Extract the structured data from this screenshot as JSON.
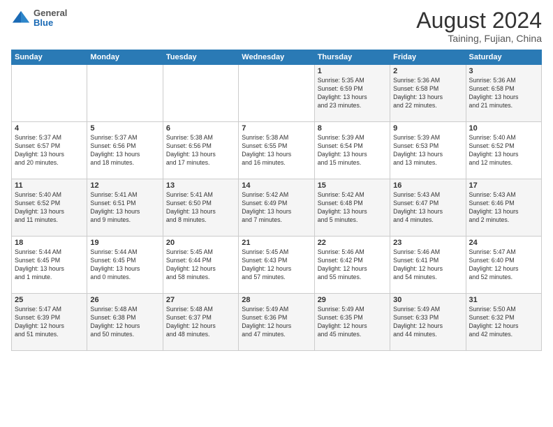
{
  "header": {
    "logo": {
      "line1": "General",
      "line2": "Blue"
    },
    "title": "August 2024",
    "location": "Taining, Fujian, China"
  },
  "weekdays": [
    "Sunday",
    "Monday",
    "Tuesday",
    "Wednesday",
    "Thursday",
    "Friday",
    "Saturday"
  ],
  "weeks": [
    [
      {
        "day": "",
        "info": ""
      },
      {
        "day": "",
        "info": ""
      },
      {
        "day": "",
        "info": ""
      },
      {
        "day": "",
        "info": ""
      },
      {
        "day": "1",
        "info": "Sunrise: 5:35 AM\nSunset: 6:59 PM\nDaylight: 13 hours\nand 23 minutes."
      },
      {
        "day": "2",
        "info": "Sunrise: 5:36 AM\nSunset: 6:58 PM\nDaylight: 13 hours\nand 22 minutes."
      },
      {
        "day": "3",
        "info": "Sunrise: 5:36 AM\nSunset: 6:58 PM\nDaylight: 13 hours\nand 21 minutes."
      }
    ],
    [
      {
        "day": "4",
        "info": "Sunrise: 5:37 AM\nSunset: 6:57 PM\nDaylight: 13 hours\nand 20 minutes."
      },
      {
        "day": "5",
        "info": "Sunrise: 5:37 AM\nSunset: 6:56 PM\nDaylight: 13 hours\nand 18 minutes."
      },
      {
        "day": "6",
        "info": "Sunrise: 5:38 AM\nSunset: 6:56 PM\nDaylight: 13 hours\nand 17 minutes."
      },
      {
        "day": "7",
        "info": "Sunrise: 5:38 AM\nSunset: 6:55 PM\nDaylight: 13 hours\nand 16 minutes."
      },
      {
        "day": "8",
        "info": "Sunrise: 5:39 AM\nSunset: 6:54 PM\nDaylight: 13 hours\nand 15 minutes."
      },
      {
        "day": "9",
        "info": "Sunrise: 5:39 AM\nSunset: 6:53 PM\nDaylight: 13 hours\nand 13 minutes."
      },
      {
        "day": "10",
        "info": "Sunrise: 5:40 AM\nSunset: 6:52 PM\nDaylight: 13 hours\nand 12 minutes."
      }
    ],
    [
      {
        "day": "11",
        "info": "Sunrise: 5:40 AM\nSunset: 6:52 PM\nDaylight: 13 hours\nand 11 minutes."
      },
      {
        "day": "12",
        "info": "Sunrise: 5:41 AM\nSunset: 6:51 PM\nDaylight: 13 hours\nand 9 minutes."
      },
      {
        "day": "13",
        "info": "Sunrise: 5:41 AM\nSunset: 6:50 PM\nDaylight: 13 hours\nand 8 minutes."
      },
      {
        "day": "14",
        "info": "Sunrise: 5:42 AM\nSunset: 6:49 PM\nDaylight: 13 hours\nand 7 minutes."
      },
      {
        "day": "15",
        "info": "Sunrise: 5:42 AM\nSunset: 6:48 PM\nDaylight: 13 hours\nand 5 minutes."
      },
      {
        "day": "16",
        "info": "Sunrise: 5:43 AM\nSunset: 6:47 PM\nDaylight: 13 hours\nand 4 minutes."
      },
      {
        "day": "17",
        "info": "Sunrise: 5:43 AM\nSunset: 6:46 PM\nDaylight: 13 hours\nand 2 minutes."
      }
    ],
    [
      {
        "day": "18",
        "info": "Sunrise: 5:44 AM\nSunset: 6:45 PM\nDaylight: 13 hours\nand 1 minute."
      },
      {
        "day": "19",
        "info": "Sunrise: 5:44 AM\nSunset: 6:45 PM\nDaylight: 13 hours\nand 0 minutes."
      },
      {
        "day": "20",
        "info": "Sunrise: 5:45 AM\nSunset: 6:44 PM\nDaylight: 12 hours\nand 58 minutes."
      },
      {
        "day": "21",
        "info": "Sunrise: 5:45 AM\nSunset: 6:43 PM\nDaylight: 12 hours\nand 57 minutes."
      },
      {
        "day": "22",
        "info": "Sunrise: 5:46 AM\nSunset: 6:42 PM\nDaylight: 12 hours\nand 55 minutes."
      },
      {
        "day": "23",
        "info": "Sunrise: 5:46 AM\nSunset: 6:41 PM\nDaylight: 12 hours\nand 54 minutes."
      },
      {
        "day": "24",
        "info": "Sunrise: 5:47 AM\nSunset: 6:40 PM\nDaylight: 12 hours\nand 52 minutes."
      }
    ],
    [
      {
        "day": "25",
        "info": "Sunrise: 5:47 AM\nSunset: 6:39 PM\nDaylight: 12 hours\nand 51 minutes."
      },
      {
        "day": "26",
        "info": "Sunrise: 5:48 AM\nSunset: 6:38 PM\nDaylight: 12 hours\nand 50 minutes."
      },
      {
        "day": "27",
        "info": "Sunrise: 5:48 AM\nSunset: 6:37 PM\nDaylight: 12 hours\nand 48 minutes."
      },
      {
        "day": "28",
        "info": "Sunrise: 5:49 AM\nSunset: 6:36 PM\nDaylight: 12 hours\nand 47 minutes."
      },
      {
        "day": "29",
        "info": "Sunrise: 5:49 AM\nSunset: 6:35 PM\nDaylight: 12 hours\nand 45 minutes."
      },
      {
        "day": "30",
        "info": "Sunrise: 5:49 AM\nSunset: 6:33 PM\nDaylight: 12 hours\nand 44 minutes."
      },
      {
        "day": "31",
        "info": "Sunrise: 5:50 AM\nSunset: 6:32 PM\nDaylight: 12 hours\nand 42 minutes."
      }
    ]
  ]
}
